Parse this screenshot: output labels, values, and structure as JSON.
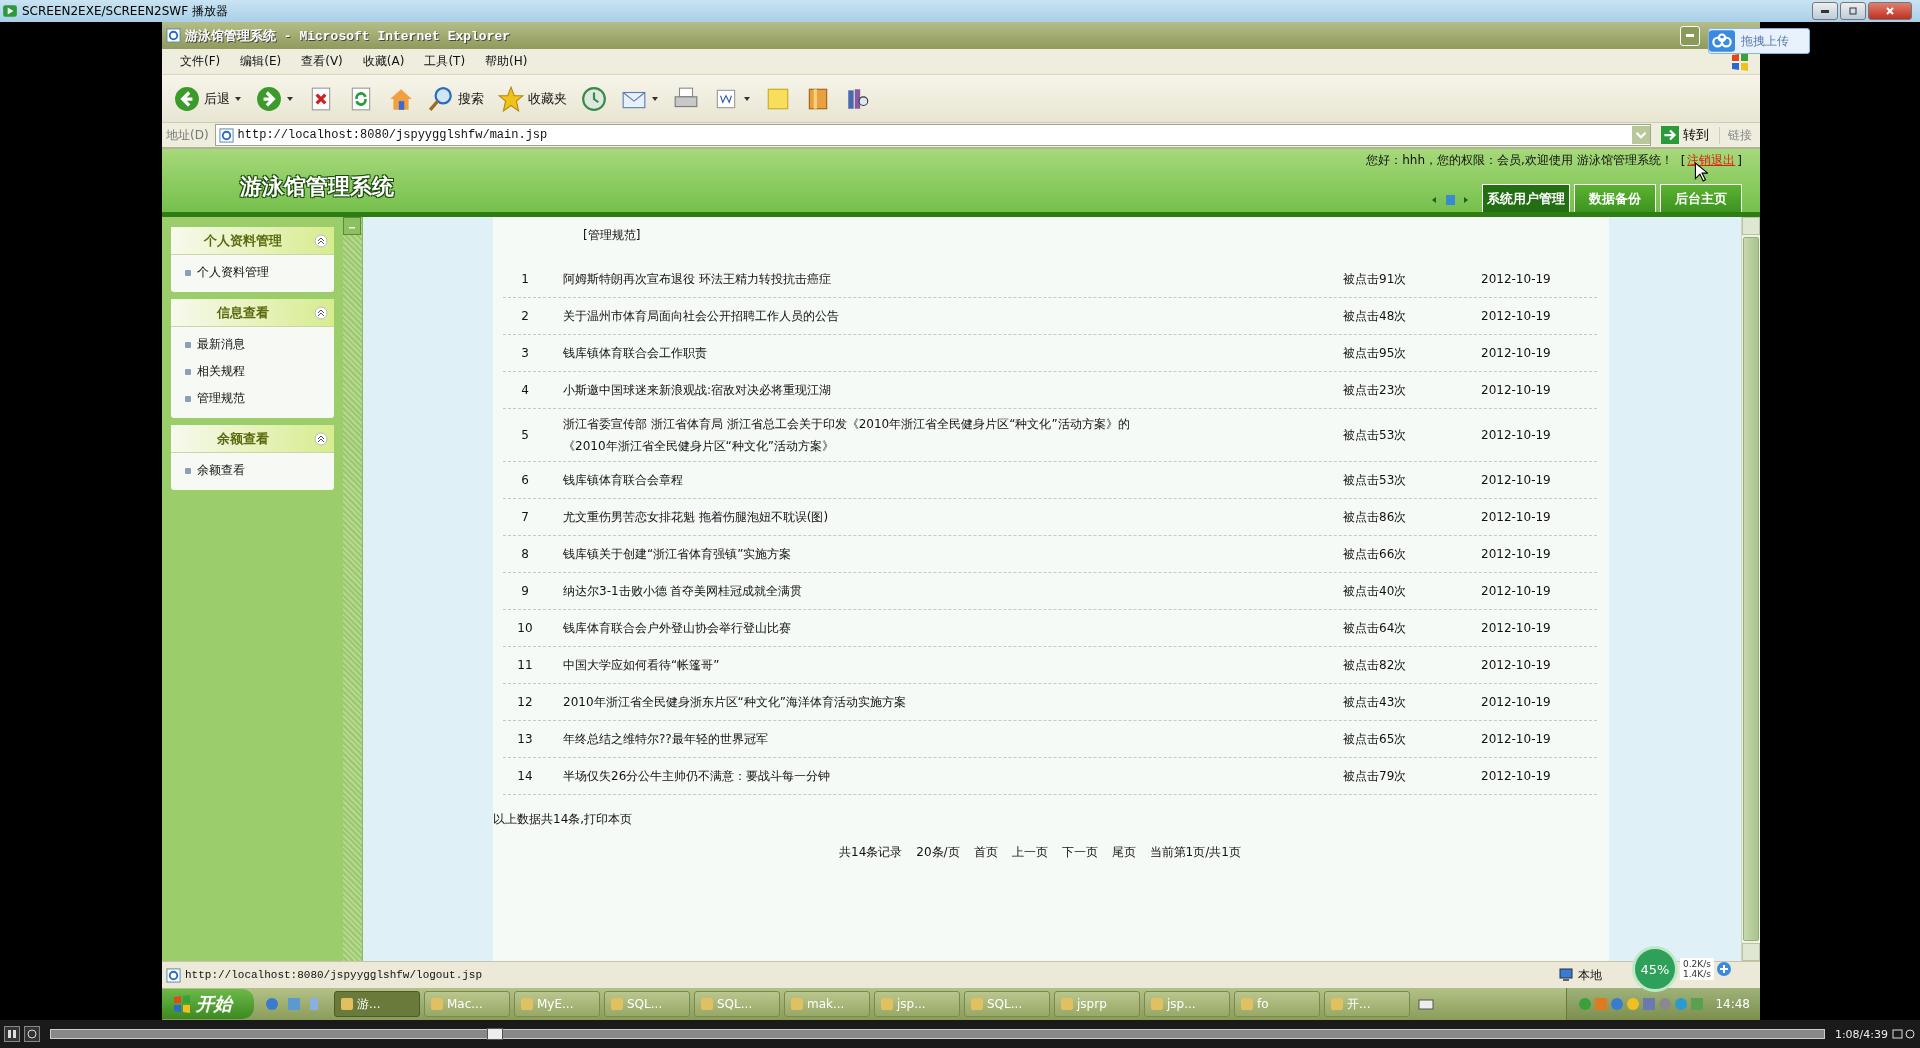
{
  "player": {
    "title": "SCREEN2EXE/SCREEN2SWF 播放器",
    "time": "1:08/4:39",
    "level": 0.25
  },
  "ie": {
    "title": "游泳馆管理系统 - Microsoft Internet Explorer",
    "menu": [
      "文件(F)",
      "编辑(E)",
      "查看(V)",
      "收藏(A)",
      "工具(T)",
      "帮助(H)"
    ],
    "toolbar": [
      {
        "kind": "back",
        "label": "后退",
        "dropdown": true
      },
      {
        "kind": "forward",
        "dropdown": true
      },
      {
        "kind": "stop",
        "dropdown": false
      },
      {
        "kind": "refresh",
        "dropdown": false
      },
      {
        "kind": "home",
        "dropdown": false
      },
      {
        "kind": "search",
        "label": "搜索",
        "dropdown": false
      },
      {
        "kind": "favorites",
        "label": "收藏夹",
        "dropdown": false
      },
      {
        "kind": "history",
        "dropdown": false
      },
      {
        "kind": "mail",
        "dropdown": true
      },
      {
        "kind": "print",
        "dropdown": false
      },
      {
        "kind": "edit",
        "dropdown": true
      },
      {
        "kind": "note",
        "dropdown": false
      },
      {
        "kind": "folder",
        "dropdown": false
      },
      {
        "kind": "research",
        "dropdown": false
      }
    ],
    "address_label": "地址(D)",
    "url": "http://localhost:8080/jspyygglshfw/main.jsp",
    "go": "转到",
    "links": "链接",
    "status_url": "http://localhost:8080/jspyygglshfw/logout.jsp",
    "zone": "本地"
  },
  "upload_badge": "拖拽上传",
  "app": {
    "title": "游泳馆管理系统",
    "greeting": "您好：hhh，您的权限：会员,欢迎使用 游泳馆管理系统！",
    "bracket_open": "[",
    "logout": "注销退出",
    "bracket_close": "]",
    "tabs": [
      {
        "label": "系统用户管理",
        "selected": true
      },
      {
        "label": "数据备份",
        "selected": false
      },
      {
        "label": "后台主页",
        "selected": false
      }
    ]
  },
  "sidebar": [
    {
      "title": "个人资料管理",
      "items": [
        "个人资料管理"
      ]
    },
    {
      "title": "信息查看",
      "items": [
        "最新消息",
        "相关规程",
        "管理规范"
      ]
    },
    {
      "title": "余额查看",
      "items": [
        "余额查看"
      ]
    }
  ],
  "content": {
    "heading": "[管理规范]",
    "rows": [
      {
        "no": "1",
        "title": "阿姆斯特朗再次宣布退役 环法王精力转投抗击癌症",
        "clicks": "被点击91次",
        "date": "2012-10-19"
      },
      {
        "no": "2",
        "title": "关于温州市体育局面向社会公开招聘工作人员的公告",
        "clicks": "被点击48次",
        "date": "2012-10-19"
      },
      {
        "no": "3",
        "title": "钱库镇体育联合会工作职责",
        "clicks": "被点击95次",
        "date": "2012-10-19"
      },
      {
        "no": "4",
        "title": "小斯邀中国球迷来新浪观战:宿敌对决必将重现江湖",
        "clicks": "被点击23次",
        "date": "2012-10-19"
      },
      {
        "no": "5",
        "title": "浙江省委宣传部 浙江省体育局 浙江省总工会关于印发《2010年浙江省全民健身片区“种文化”活动方案》的《2010年浙江省全民健身片区“种文化”活动方案》",
        "clicks": "被点击53次",
        "date": "2012-10-19"
      },
      {
        "no": "6",
        "title": "钱库镇体育联合会章程",
        "clicks": "被点击53次",
        "date": "2012-10-19"
      },
      {
        "no": "7",
        "title": "尤文重伤男苦恋女排花魁 拖着伤腿泡妞不耽误(图)",
        "clicks": "被点击86次",
        "date": "2012-10-19"
      },
      {
        "no": "8",
        "title": "钱库镇关于创建“浙江省体育强镇”实施方案",
        "clicks": "被点击66次",
        "date": "2012-10-19"
      },
      {
        "no": "9",
        "title": "纳达尔3-1击败小德 首夺美网桂冠成就全满贯",
        "clicks": "被点击40次",
        "date": "2012-10-19"
      },
      {
        "no": "10",
        "title": "钱库体育联合会户外登山协会举行登山比赛",
        "clicks": "被点击64次",
        "date": "2012-10-19"
      },
      {
        "no": "11",
        "title": "中国大学应如何看待“帐篷哥”",
        "clicks": "被点击82次",
        "date": "2012-10-19"
      },
      {
        "no": "12",
        "title": "2010年浙江省全民健身浙东片区“种文化”海洋体育活动实施方案",
        "clicks": "被点击43次",
        "date": "2012-10-19"
      },
      {
        "no": "13",
        "title": "年终总结之维特尔??最年轻的世界冠军",
        "clicks": "被点击65次",
        "date": "2012-10-19"
      },
      {
        "no": "14",
        "title": "半场仅失26分公牛主帅仍不满意：要战斗每一分钟",
        "clicks": "被点击79次",
        "date": "2012-10-19"
      }
    ],
    "summary": "以上数据共14条,",
    "print": "打印本页",
    "pager": [
      "共14条记录",
      "20条/页",
      "首页",
      "上一页",
      "下一页",
      "尾页",
      "当前第1页/共1页"
    ]
  },
  "taskbar": {
    "start": "开始",
    "items": [
      {
        "label": "游...",
        "selected": true
      },
      {
        "label": "Mac...",
        "selected": false
      },
      {
        "label": "MyE...",
        "selected": false
      },
      {
        "label": "SQL...",
        "selected": false
      },
      {
        "label": "SQL...",
        "selected": false
      },
      {
        "label": "mak...",
        "selected": false
      },
      {
        "label": "jsp...",
        "selected": false
      },
      {
        "label": "SQL...",
        "selected": false
      },
      {
        "label": "jsprp",
        "selected": false
      },
      {
        "label": "jsp...",
        "selected": false
      },
      {
        "label": "fo",
        "selected": false
      },
      {
        "label": "开...",
        "selected": false
      }
    ],
    "clock": "14:48"
  },
  "net": {
    "percent": "45%",
    "up": "0.2K/s",
    "down": "1.4K/s"
  }
}
